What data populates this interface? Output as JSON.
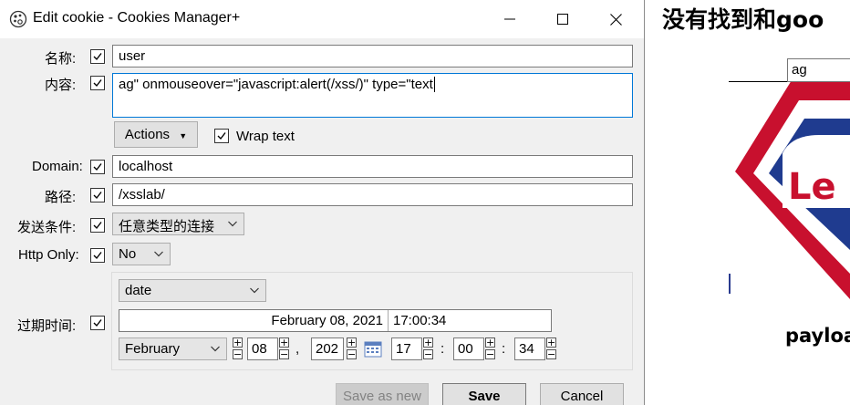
{
  "dialog": {
    "title": "Edit cookie - Cookies Manager+",
    "name_label": "名称:",
    "name_value": "user",
    "content_label": "内容:",
    "content_value": "ag\" onmouseover=\"javascript:alert(/xss/)\" type=\"text",
    "actions_label": "Actions",
    "wrap_text_label": "Wrap text",
    "domain_label": "Domain:",
    "domain_value": "localhost",
    "path_label": "路径:",
    "path_value": "/xsslab/",
    "send_label": "发送条件:",
    "send_value": "任意类型的连接",
    "httponly_label": "Http Only:",
    "httponly_value": "No",
    "expiry_label": "过期时间:",
    "expiry_type": "date",
    "expiry_date_text": "February 08, 2021",
    "expiry_time_text": "17:00:34",
    "month": "February",
    "day": "08",
    "date_sep": ",",
    "year": "202",
    "hour": "17",
    "minute": "00",
    "second": "34",
    "time_sep": ":",
    "save_as_new": "Save as new",
    "save": "Save",
    "cancel": "Cancel"
  },
  "background": {
    "heading": "没有找到和goo",
    "input_value": "ag",
    "caption": "payloa"
  },
  "colors": {
    "accent": "#0078d7",
    "check": "#000000",
    "logo_red": "#c8102e",
    "logo_blue": "#1f3b8f"
  }
}
